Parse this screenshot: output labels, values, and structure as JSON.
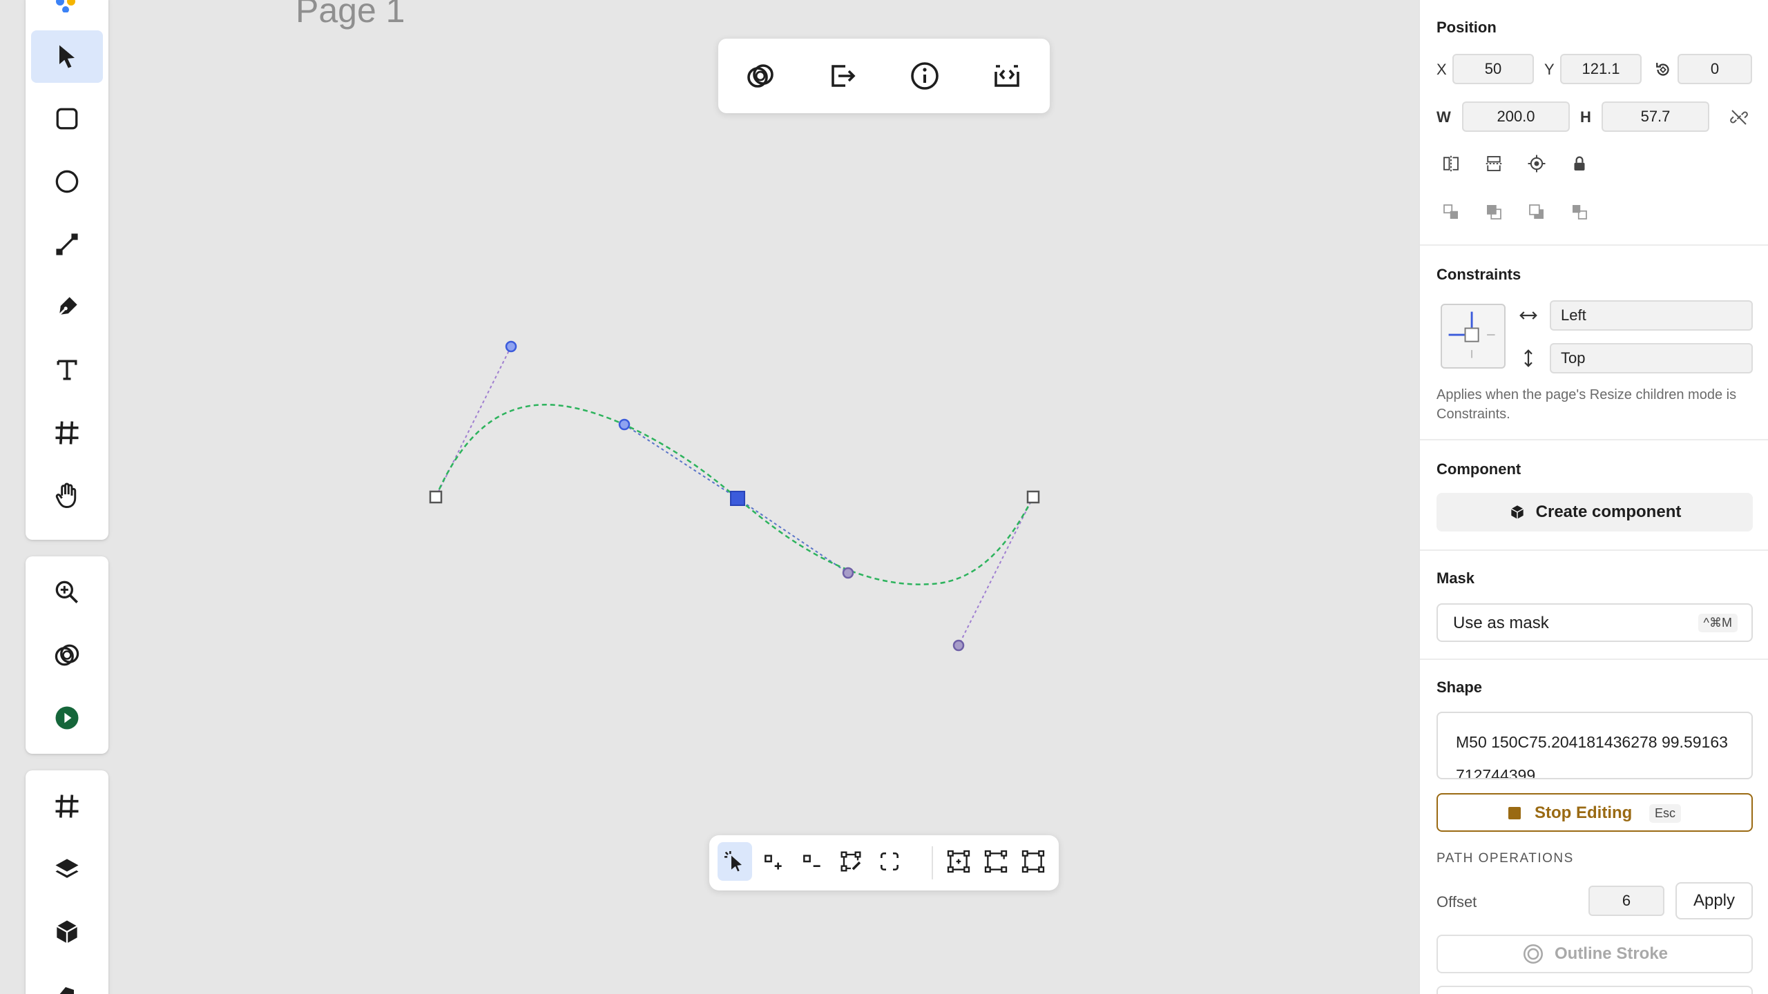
{
  "page": {
    "title": "Page 1"
  },
  "colors": {
    "accent": "#3b5bdb",
    "active_tool_bg": "#dbe7fb",
    "curve": "#2db35d",
    "handle_line": "#a07fd1",
    "stop_editing": "#9a6a13",
    "play": "#15663a"
  },
  "left_toolbar": {
    "tools": [
      "move-icon",
      "rectangle-icon",
      "ellipse-icon",
      "line-icon",
      "pen-icon",
      "text-icon",
      "frame-icon",
      "hand-icon"
    ],
    "secondary": [
      "zoom-icon",
      "boolean-icon",
      "play-icon"
    ],
    "tertiary": [
      "frame-icon",
      "layers-icon",
      "component-icon"
    ]
  },
  "top_toolbar": {
    "buttons": [
      "boolean-icon",
      "export-icon",
      "info-icon",
      "embed-code-icon"
    ]
  },
  "path_toolbar": {
    "buttons": [
      "select-points-icon",
      "add-point-icon",
      "remove-point-icon",
      "edit-curve-icon",
      "close-path-icon",
      "align-points-icon",
      "break-path-icon",
      "join-path-icon"
    ]
  },
  "position": {
    "title": "Position",
    "x_label": "X",
    "x_value": "50",
    "y_label": "Y",
    "y_value": "121.1",
    "rotation_value": "0",
    "w_label": "W",
    "w_value": "200.0",
    "h_label": "H",
    "h_value": "57.7"
  },
  "constraints": {
    "title": "Constraints",
    "horizontal": "Left",
    "vertical": "Top",
    "note": "Applies when the page's Resize children mode is Constraints."
  },
  "component": {
    "title": "Component",
    "create_label": "Create component"
  },
  "mask": {
    "title": "Mask",
    "use_label": "Use as mask",
    "shortcut": "^⌘M"
  },
  "shape": {
    "title": "Shape",
    "path_text": "M50 150C75.204181436278 99.59163712744399",
    "stop_label": "Stop Editing",
    "stop_shortcut": "Esc",
    "path_ops_title": "PATH OPERATIONS",
    "offset_label": "Offset",
    "offset_value": "6",
    "apply_label": "Apply",
    "outline_label": "Outline Stroke"
  }
}
